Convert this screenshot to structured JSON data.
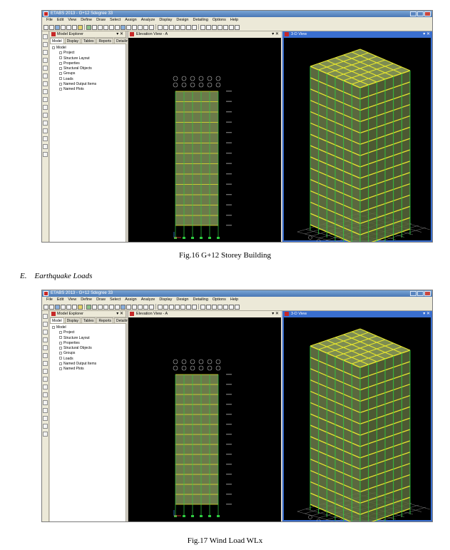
{
  "figures": [
    {
      "id": "fig16",
      "window_title": "ETABS 2013 - G+12  Sdegree  33",
      "menus": [
        "File",
        "Edit",
        "View",
        "Define",
        "Draw",
        "Select",
        "Assign",
        "Analyze",
        "Display",
        "Design",
        "Detailing",
        "Options",
        "Help"
      ],
      "explorer": {
        "title": "Model Explorer",
        "tabs": [
          "Model",
          "Display",
          "Tables",
          "Reports",
          "Detailing"
        ],
        "root": "Model",
        "items": [
          "Project",
          "Structure Layout",
          "Properties",
          "Structural Objects",
          "Groups",
          "Loads",
          "Named Output Items",
          "Named Plots"
        ]
      },
      "elevation_title": "Elevation View - A",
      "view3d_title": "3-D View",
      "caption": "Fig.16 G+12 Storey Building"
    },
    {
      "id": "fig17",
      "window_title": "ETABS 2013 - G+12  Sdegree  33",
      "menus": [
        "File",
        "Edit",
        "View",
        "Define",
        "Draw",
        "Select",
        "Assign",
        "Analyze",
        "Display",
        "Design",
        "Detailing",
        "Options",
        "Help"
      ],
      "explorer": {
        "title": "Model Explorer",
        "tabs": [
          "Model",
          "Display",
          "Tables",
          "Reports",
          "Detailing"
        ],
        "root": "Model",
        "items": [
          "Project",
          "Structure Layout",
          "Properties",
          "Structural Objects",
          "Groups",
          "Loads",
          "Named Output Items",
          "Named Plots"
        ]
      },
      "elevation_title": "Elevation View - A",
      "view3d_title": "3-D View",
      "caption": "Fig.17 Wind Load WLx"
    }
  ],
  "section": {
    "number": "E.",
    "title": "Earthquake Loads"
  },
  "colors": {
    "viewport_bg": "#000000",
    "frame_line": "#e6e62e",
    "column_line": "#2ecc40",
    "wall_fill": "#6b7a4a",
    "grid_line": "#9a9a9a",
    "active_window": "#3a6fd0"
  }
}
